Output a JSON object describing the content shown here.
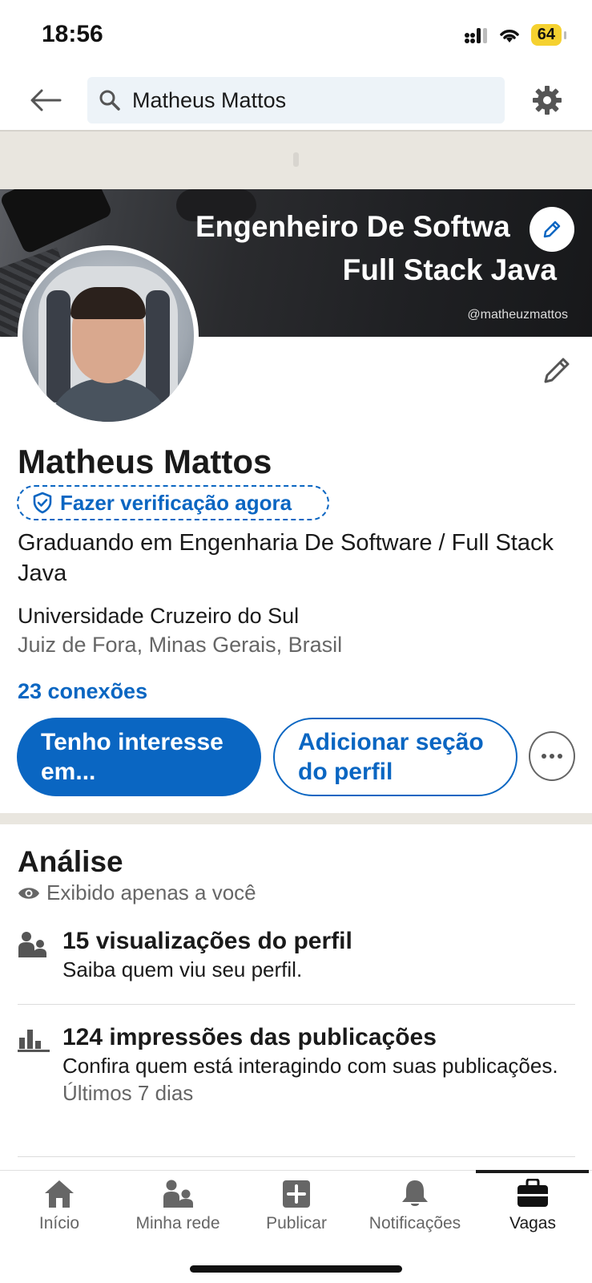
{
  "status": {
    "time": "18:56",
    "battery": "64"
  },
  "header": {
    "search_value": "Matheus Mattos"
  },
  "banner": {
    "line1": "Engenheiro De Softwa",
    "line2": "Full Stack Java",
    "handle": "@matheuzmattos"
  },
  "profile": {
    "name": "Matheus Mattos",
    "verify_label": "Fazer verificação agora",
    "headline": "Graduando em Engenharia De Software / Full Stack Java",
    "education": "Universidade Cruzeiro do Sul",
    "location": "Juiz de Fora, Minas Gerais, Brasil",
    "connections": "23 conexões",
    "primary_button": "Tenho interesse em...",
    "secondary_button": "Adicionar seção do perfil"
  },
  "analytics": {
    "title": "Análise",
    "private_note": "Exibido apenas a você",
    "items": [
      {
        "title": "15 visualizações do perfil",
        "subtitle": "Saiba quem viu seu perfil.",
        "icon": "people-icon"
      },
      {
        "title": "124 impressões das publicações",
        "subtitle": "Confira quem está interagindo com suas publicações.",
        "note": "Últimos 7 dias",
        "icon": "bar-chart-icon"
      }
    ]
  },
  "nav": {
    "items": [
      {
        "label": "Início",
        "icon": "home-icon"
      },
      {
        "label": "Minha rede",
        "icon": "network-icon"
      },
      {
        "label": "Publicar",
        "icon": "plus-icon"
      },
      {
        "label": "Notificações",
        "icon": "bell-icon"
      },
      {
        "label": "Vagas",
        "icon": "briefcase-icon"
      }
    ],
    "active": "Vagas"
  },
  "colors": {
    "brand": "#0a66c2",
    "separator": "#e9e6df",
    "battery": "#f5d130"
  }
}
